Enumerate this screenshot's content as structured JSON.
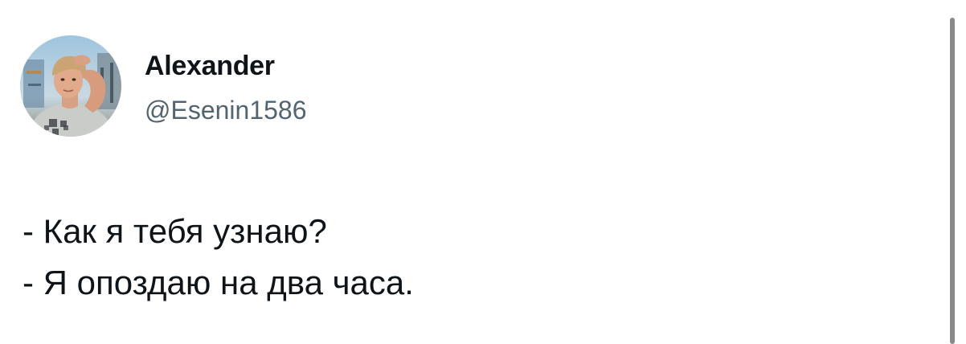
{
  "tweet": {
    "author": {
      "display_name": "Alexander",
      "handle": "@Esenin1586"
    },
    "text_lines": [
      "- Как я тебя узнаю?",
      "- Я опоздаю на два часа."
    ]
  },
  "icons": {
    "avatar": "profile-photo"
  },
  "colors": {
    "text_primary": "#0f1419",
    "text_secondary": "#536471",
    "background": "#ffffff",
    "scrollbar": "#8a8a8a"
  }
}
